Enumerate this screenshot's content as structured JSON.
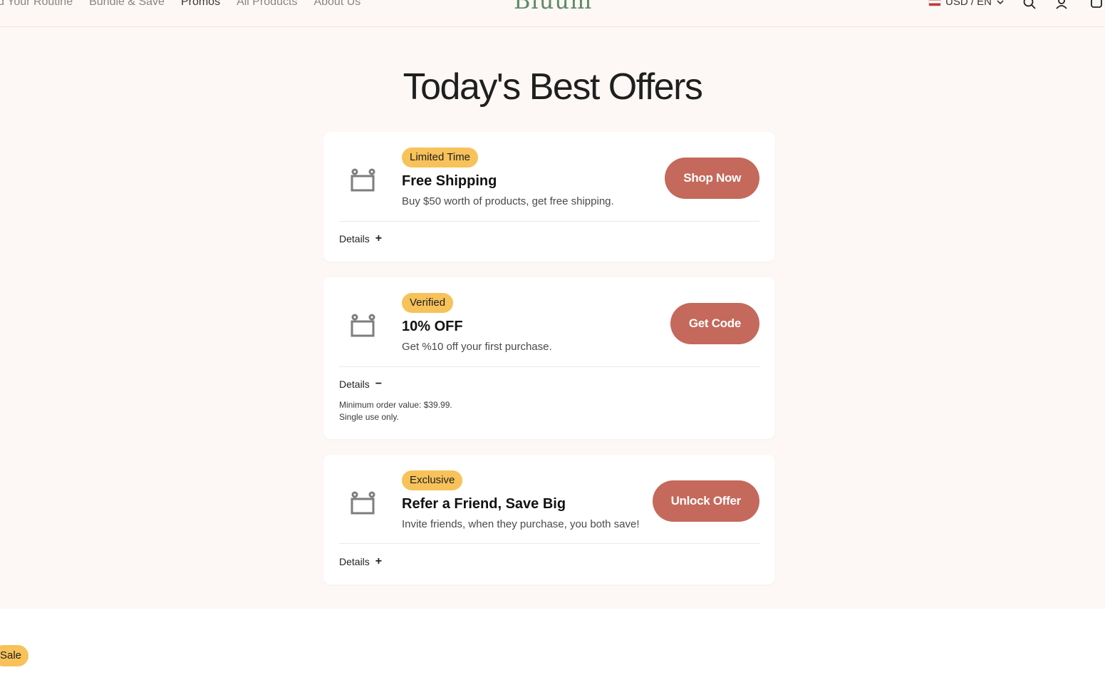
{
  "nav": {
    "items": [
      {
        "label": "ild Your Routine"
      },
      {
        "label": "Bundle & Save"
      },
      {
        "label": "Promos"
      },
      {
        "label": "All Products"
      },
      {
        "label": "About Us"
      }
    ],
    "logo": "Bluum",
    "locale": "USD / EN"
  },
  "page": {
    "title": "Today's Best Offers"
  },
  "offers": [
    {
      "badge": "Limited Time",
      "title": "Free Shipping",
      "description": "Buy $50 worth of products, get free shipping.",
      "cta": "Shop Now",
      "details_label": "Details",
      "toggle": "+"
    },
    {
      "badge": "Verified",
      "title": "10% OFF",
      "description": "Get %10 off your first purchase.",
      "cta": "Get Code",
      "details_label": "Details",
      "toggle": "−",
      "notes": [
        "Minimum order value: $39.99.",
        "Single use only."
      ]
    },
    {
      "badge": "Exclusive",
      "title": "Refer a Friend, Save Big",
      "description": "Invite friends, when they purchase, you both save!",
      "cta": "Unlock Offer",
      "details_label": "Details",
      "toggle": "+"
    }
  ],
  "sale_badge": "Sale",
  "colors": {
    "background": "#fdf8f5",
    "badge": "#f7c25a",
    "cta": "#c4695b",
    "logo": "#5f8a6a"
  }
}
